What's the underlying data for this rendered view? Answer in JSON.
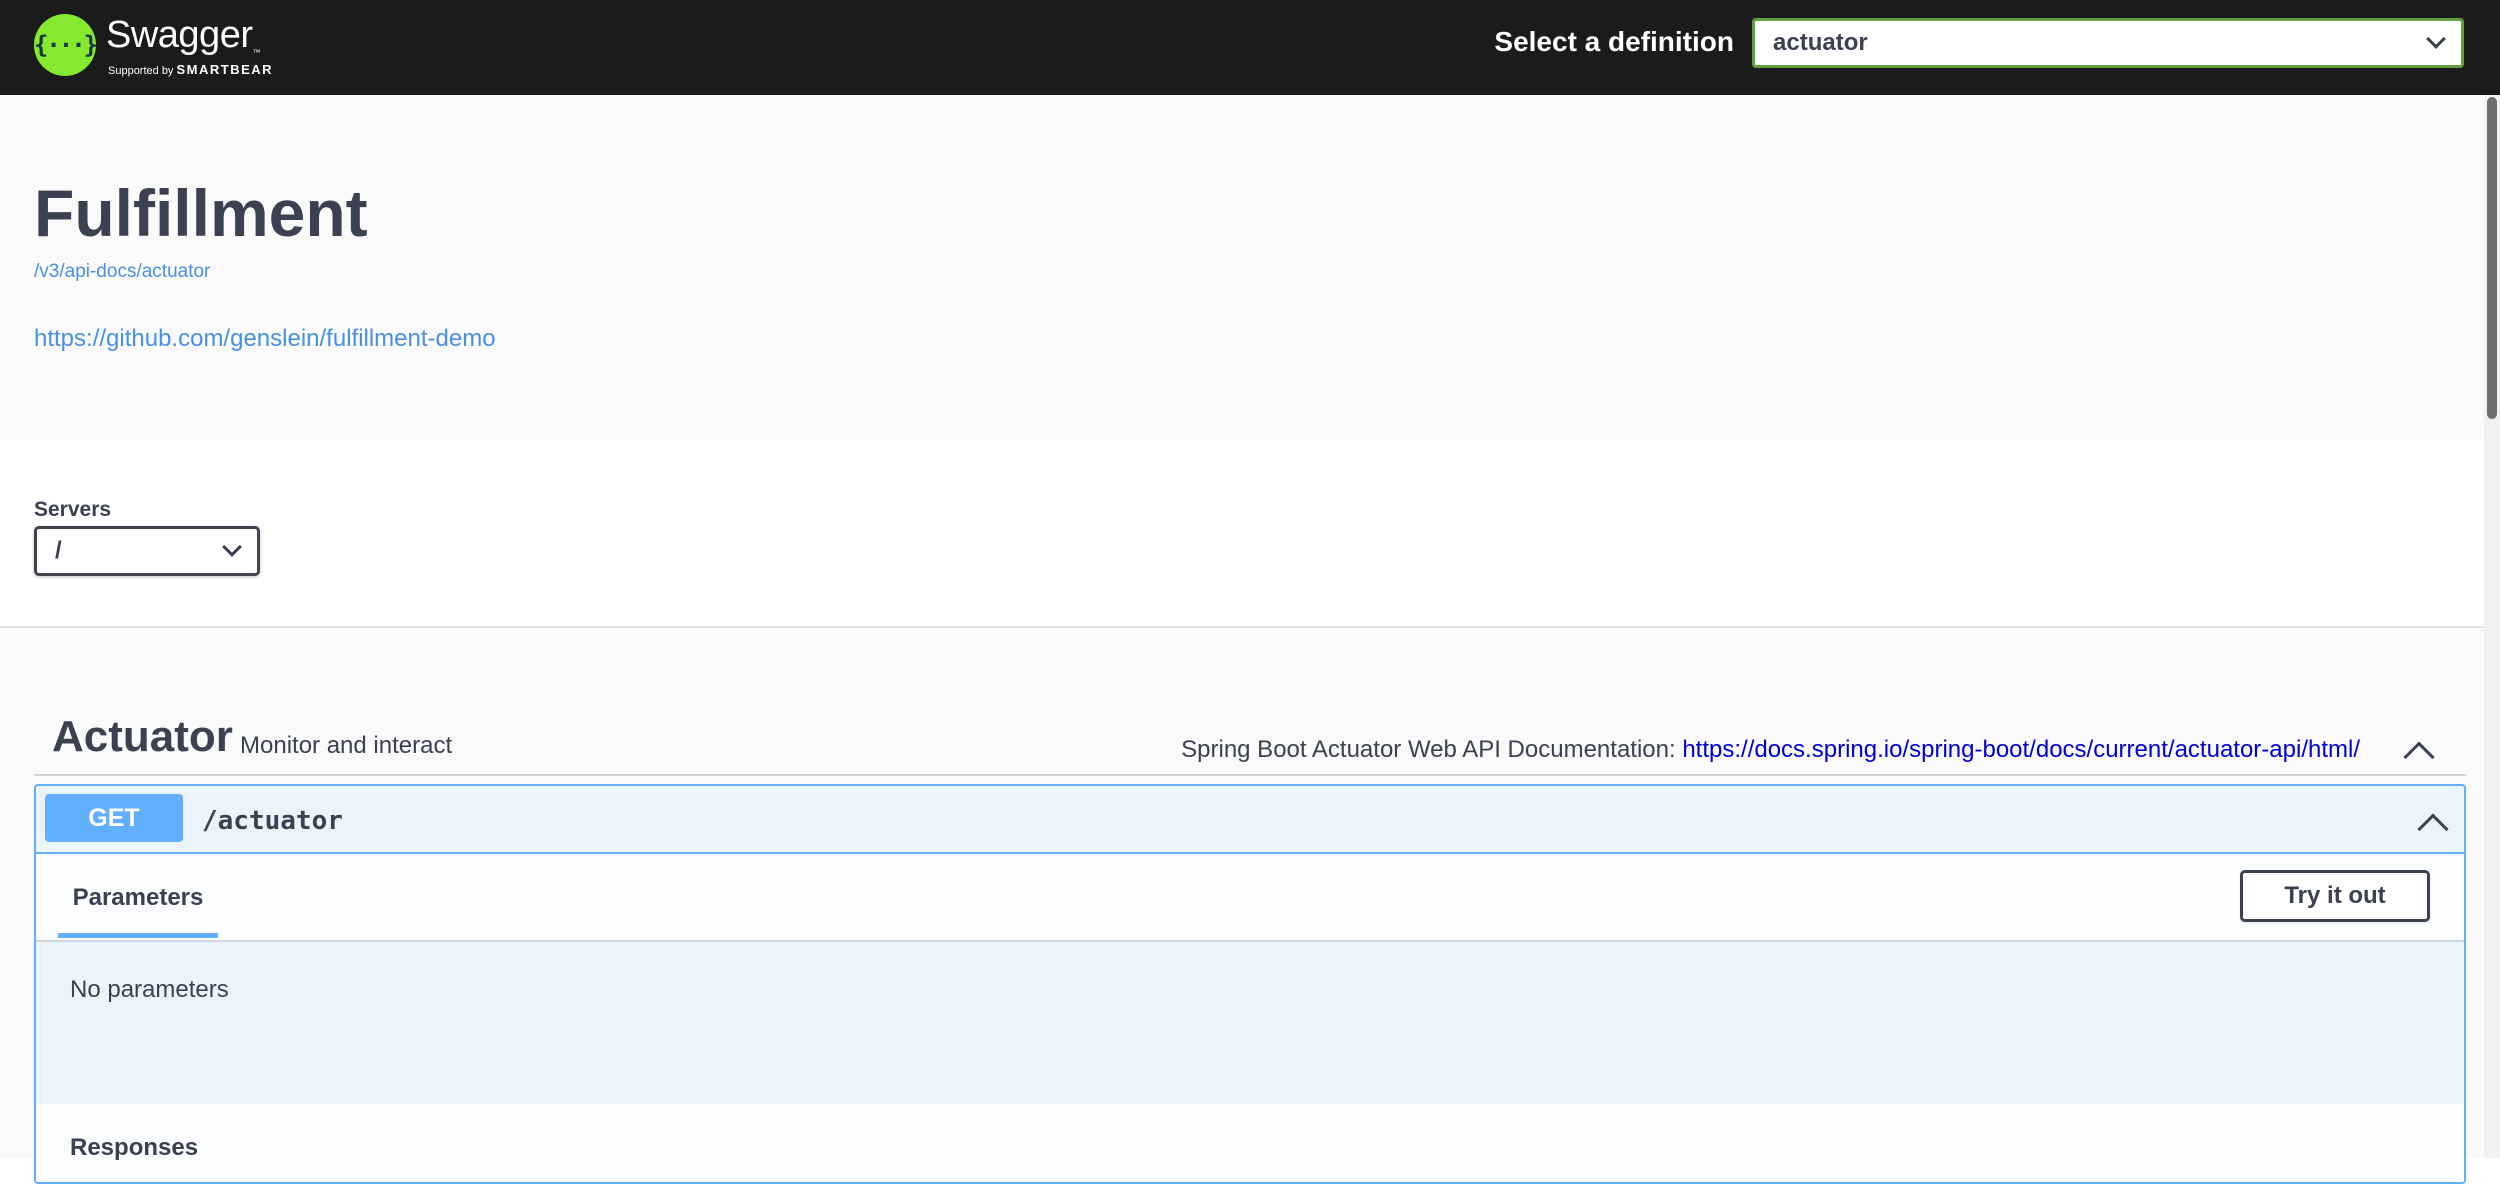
{
  "topbar": {
    "logo_name": "Swagger",
    "logo_tm": "™",
    "logo_supported": "Supported by",
    "logo_company": "SMARTBEAR",
    "definition_label": "Select a definition",
    "definition_value": "actuator"
  },
  "info": {
    "title": "Fulfillment",
    "spec_url": "/v3/api-docs/actuator",
    "repo_url": "https://github.com/genslein/fulfillment-demo"
  },
  "servers": {
    "label": "Servers",
    "selected": "/"
  },
  "tag": {
    "name": "Actuator",
    "description": "Monitor and interact",
    "external_doc_label": "Spring Boot Actuator Web API Documentation:",
    "external_doc_url": "https://docs.spring.io/spring-boot/docs/current/actuator-api/html/"
  },
  "operation": {
    "method": "GET",
    "path": "/actuator",
    "tab_parameters": "Parameters",
    "try_it_out": "Try it out",
    "no_parameters": "No parameters",
    "responses_label": "Responses"
  },
  "icons": {
    "definition_chevron": "chevron-down-icon",
    "servers_chevron": "chevron-down-icon",
    "tag_toggle": "chevron-up-icon",
    "operation_toggle": "chevron-up-icon"
  },
  "colors": {
    "topbar_bg": "#1b1b1b",
    "logo_green": "#85ea2d",
    "select_border": "#62a03f",
    "get_blue": "#61affe",
    "link_blue": "#4990e2",
    "external_link": "#0000d6",
    "text": "#3b4151"
  }
}
